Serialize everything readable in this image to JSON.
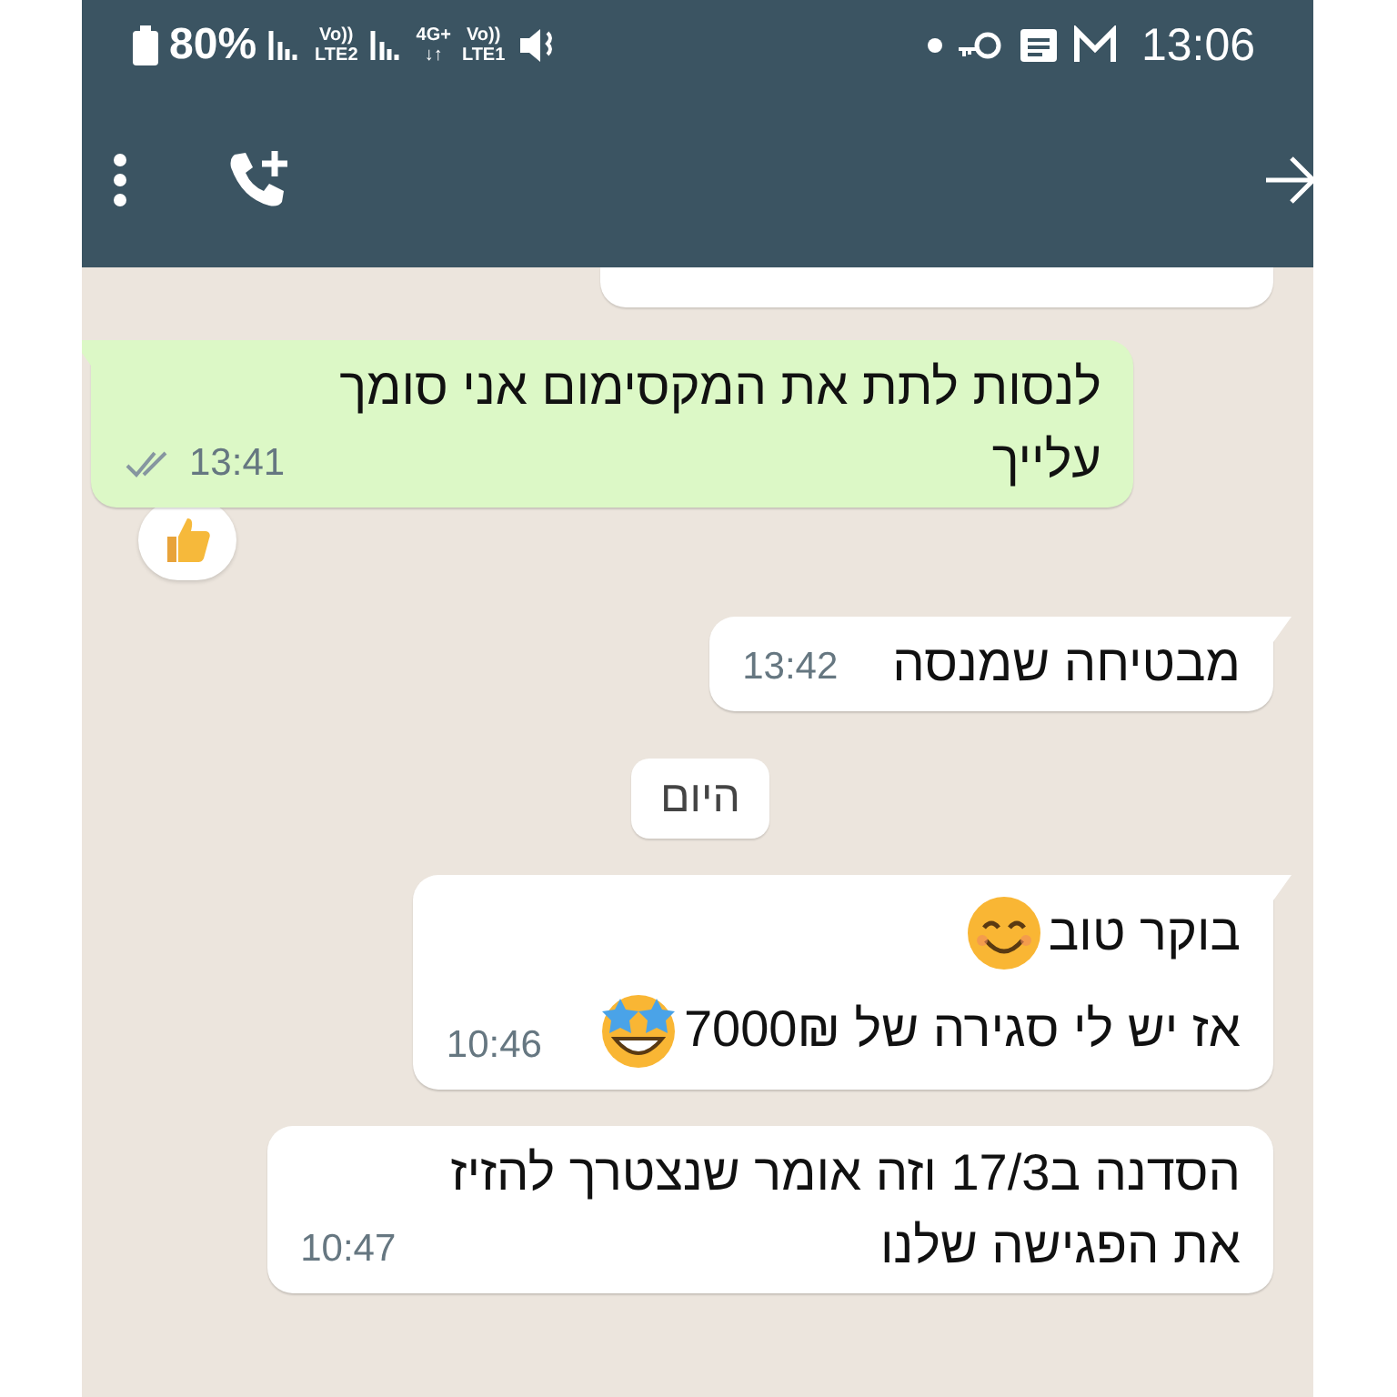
{
  "status_bar": {
    "battery": "80%",
    "sim2": {
      "top": "Vo))",
      "bottom": "LTE2"
    },
    "network": {
      "top": "4G+",
      "bottom": "↓↑"
    },
    "sim1": {
      "top": "Vo))",
      "bottom": "LTE1"
    },
    "time": "13:06"
  },
  "messages": [
    {
      "kind": "fragment",
      "outgoing": false
    },
    {
      "kind": "text",
      "outgoing": true,
      "lines": [
        {
          "text": "לנסות לתת את המקסימום אני סומך"
        },
        {
          "text": "עלייך"
        }
      ],
      "time": "13:41",
      "delivered": true,
      "reaction": true,
      "tail": true
    },
    {
      "kind": "text",
      "outgoing": false,
      "lines": [
        {
          "text": "מבטיחה שמנסה"
        }
      ],
      "time": "13:42",
      "tail": true
    },
    {
      "kind": "date",
      "label": "היום"
    },
    {
      "kind": "text",
      "outgoing": false,
      "lines": [
        {
          "kind": "smiling",
          "text": "בוקר טוב"
        },
        {
          "kind": "star-struck",
          "text": "אז יש לי סגירה של 7000₪"
        }
      ],
      "time": "10:46",
      "tail": true
    },
    {
      "kind": "text",
      "outgoing": false,
      "lines": [
        {
          "text": "הסדנה ב17/3 וזה אומר שנצטרך להזיז"
        },
        {
          "text": "את הפגישה שלנו"
        }
      ],
      "time": "10:47",
      "tail": false
    }
  ]
}
